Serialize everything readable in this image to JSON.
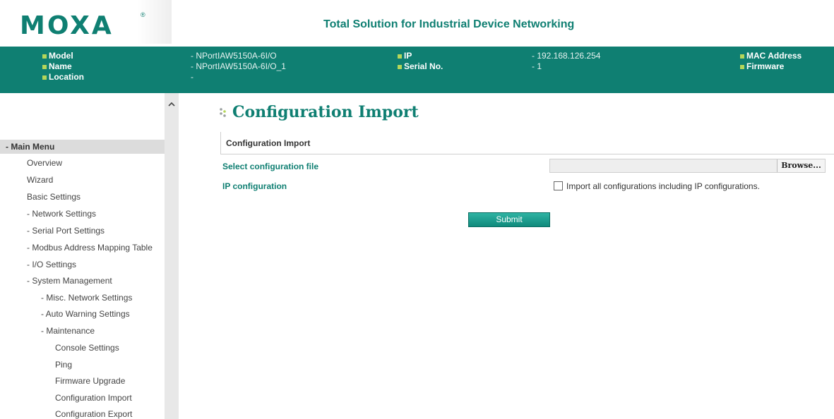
{
  "header": {
    "logo_text": "MOXA",
    "logo_mark": "®",
    "tagline": "Total Solution for Industrial Device Networking"
  },
  "infobar": {
    "model_label": "Model",
    "model_value": "- NPortIAW5150A-6I/O",
    "name_label": "Name",
    "name_value": "- NPortIAW5150A-6I/O_1",
    "location_label": "Location",
    "location_value": "-",
    "ip_label": "IP",
    "ip_value": "- 192.168.126.254",
    "serial_label": "Serial No.",
    "serial_value": "- 1",
    "mac_label": "MAC Address",
    "firmware_label": "Firmware"
  },
  "sidebar": {
    "header": "- Main Menu",
    "items": [
      "Overview",
      "Wizard",
      "Basic Settings",
      "- Network Settings",
      "- Serial Port Settings",
      "- Modbus Address Mapping Table",
      "- I/O Settings",
      "- System Management",
      "- Misc. Network Settings",
      "- Auto Warning Settings",
      "- Maintenance",
      "Console Settings",
      "Ping",
      "Firmware Upgrade",
      "Configuration Import",
      "Configuration Export"
    ]
  },
  "main": {
    "title": "Configuration Import",
    "section": "Configuration Import",
    "select_label": "Select configuration file",
    "browse_label": "Browse...",
    "ip_label": "IP configuration",
    "checkbox_label": "Import all configurations including IP configurations.",
    "submit_label": "Submit"
  },
  "colors": {
    "brand": "#0f7f72",
    "accent_bullet": "#b5d65a"
  }
}
